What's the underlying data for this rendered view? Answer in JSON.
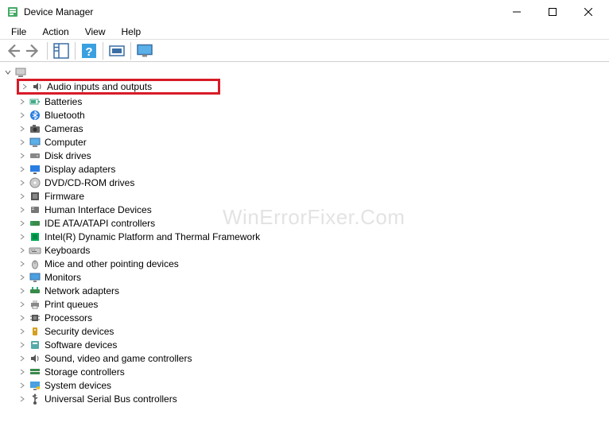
{
  "window": {
    "title": "Device Manager"
  },
  "menu": {
    "file": "File",
    "action": "Action",
    "view": "View",
    "help": "Help"
  },
  "tree": {
    "root": "",
    "items": [
      {
        "label": "Audio inputs and outputs",
        "highlighted": true
      },
      {
        "label": "Batteries"
      },
      {
        "label": "Bluetooth"
      },
      {
        "label": "Cameras"
      },
      {
        "label": "Computer"
      },
      {
        "label": "Disk drives"
      },
      {
        "label": "Display adapters"
      },
      {
        "label": "DVD/CD-ROM drives"
      },
      {
        "label": "Firmware"
      },
      {
        "label": "Human Interface Devices"
      },
      {
        "label": "IDE ATA/ATAPI controllers"
      },
      {
        "label": "Intel(R) Dynamic Platform and Thermal Framework"
      },
      {
        "label": "Keyboards"
      },
      {
        "label": "Mice and other pointing devices"
      },
      {
        "label": "Monitors"
      },
      {
        "label": "Network adapters"
      },
      {
        "label": "Print queues"
      },
      {
        "label": "Processors"
      },
      {
        "label": "Security devices"
      },
      {
        "label": "Software devices"
      },
      {
        "label": "Sound, video and game controllers"
      },
      {
        "label": "Storage controllers"
      },
      {
        "label": "System devices"
      },
      {
        "label": "Universal Serial Bus controllers"
      }
    ]
  },
  "watermark": "WinErrorFixer.Com"
}
